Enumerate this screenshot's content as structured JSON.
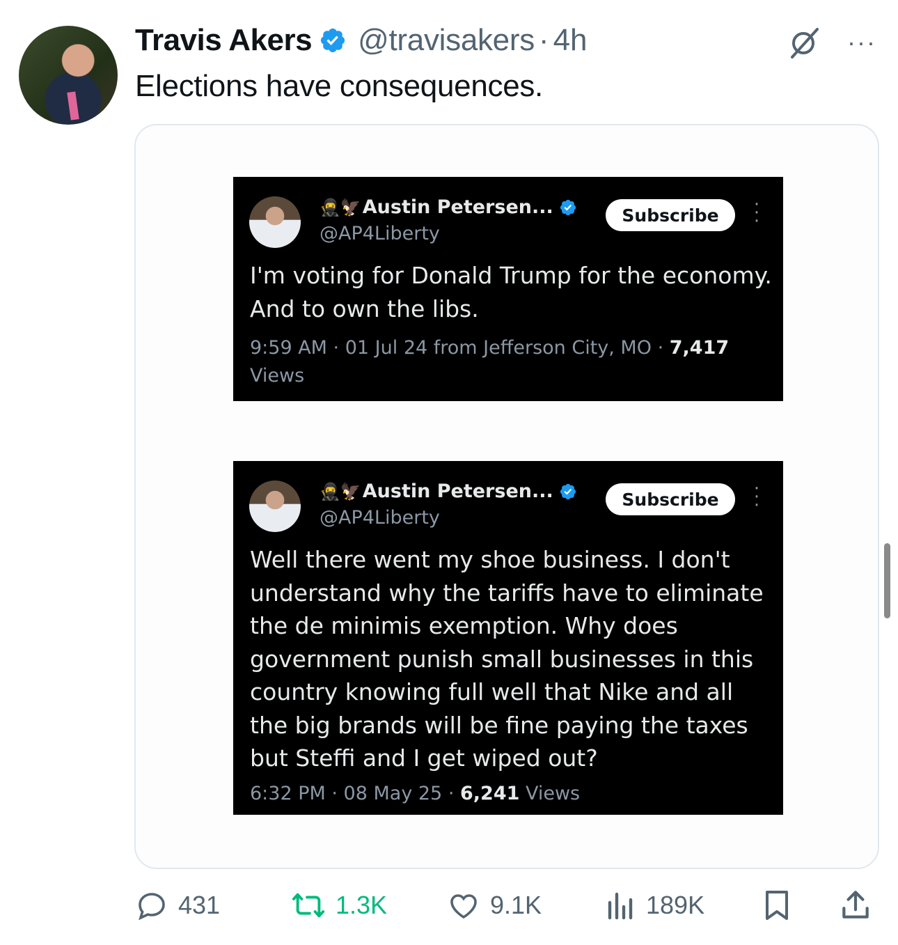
{
  "tweet": {
    "author_name": "Travis Akers",
    "handle": "@travisakers",
    "separator": "·",
    "time": "4h",
    "text": "Elections have consequences.",
    "more_label": "···"
  },
  "quoted_cards": [
    {
      "emoji": "🥷🦅",
      "name": "Austin Petersen...",
      "handle": "@AP4Liberty",
      "subscribe_label": "Subscribe",
      "text": "I'm voting for Donald Trump for the economy. And to own the libs.",
      "meta_prefix": "9:59 AM · 01 Jul 24 from Jefferson City, MO · ",
      "views_count": "7,417",
      "views_label": " Views"
    },
    {
      "emoji": "🥷🦅",
      "name": "Austin Petersen...",
      "handle": "@AP4Liberty",
      "subscribe_label": "Subscribe",
      "text": "Well there went my shoe business. I don't understand why the tariffs have to eliminate the de minimis exemption. Why does government punish small businesses in this country knowing full well that Nike and all the big brands will be fine paying the taxes but Steffi and I get wiped out?",
      "meta_prefix": "6:32 PM · 08 May 25 · ",
      "views_count": "6,241",
      "views_label": " Views"
    }
  ],
  "actions": {
    "replies": "431",
    "retweets": "1.3K",
    "likes": "9.1K",
    "views": "189K"
  },
  "colors": {
    "verified": "#1d9bf0",
    "retweet": "#00ba7c",
    "secondary_text": "#536471"
  }
}
